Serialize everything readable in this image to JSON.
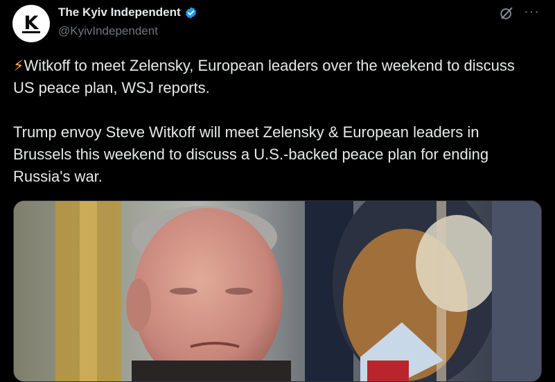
{
  "author": {
    "display_name": "The Kyiv Independent",
    "handle": "@KyivIndependent",
    "avatar_letter": "K",
    "verified": true
  },
  "icons": [
    "verified-badge-icon",
    "grok-icon",
    "more-icon",
    "lightning-icon"
  ],
  "post": {
    "bolt": "⚡",
    "line1": "Witkoff to meet Zelensky, European leaders over the weekend to discuss US peace plan, WSJ reports.",
    "line2": "Trump envoy Steve Witkoff will meet Zelensky & European leaders in Brussels this weekend to discuss a U.S.-backed peace plan for ending Russia's war."
  },
  "colors": {
    "background": "#000000",
    "text": "#e7e9ea",
    "secondary": "#71767b",
    "verified": "#1d9bf0",
    "bolt": "#ffac33"
  }
}
